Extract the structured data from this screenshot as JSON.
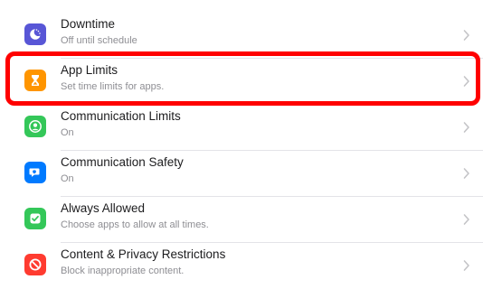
{
  "colors": {
    "highlight_border": "#ff0000",
    "downtime": "#5856d6",
    "app_limits": "#ff9500",
    "communication_limits": "#34c759",
    "communication_safety": "#007aff",
    "always_allowed": "#34c759",
    "content_privacy": "#ff3b30"
  },
  "items": [
    {
      "title": "Downtime",
      "subtitle": "Off until schedule",
      "icon": "downtime-icon"
    },
    {
      "title": "App Limits",
      "subtitle": "Set time limits for apps.",
      "icon": "hourglass-icon"
    },
    {
      "title": "Communication Limits",
      "subtitle": "On",
      "icon": "person-circle-icon"
    },
    {
      "title": "Communication Safety",
      "subtitle": "On",
      "icon": "chat-bubble-icon"
    },
    {
      "title": "Always Allowed",
      "subtitle": "Choose apps to allow at all times.",
      "icon": "checkmark-icon"
    },
    {
      "title": "Content & Privacy Restrictions",
      "subtitle": "Block inappropriate content.",
      "icon": "no-entry-icon"
    }
  ]
}
